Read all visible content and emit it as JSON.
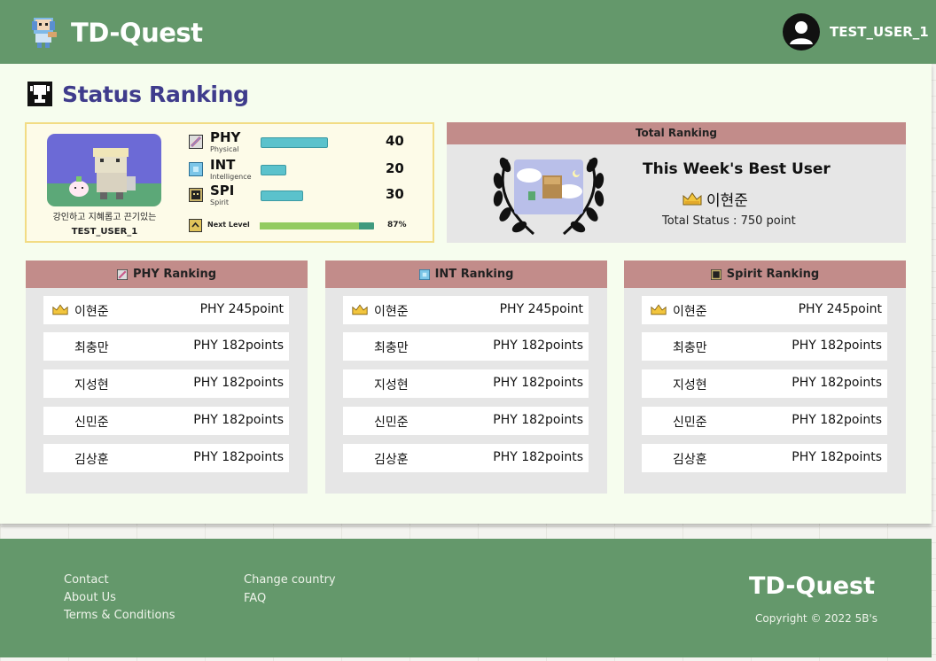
{
  "header": {
    "brand": "TD-Quest",
    "username": "TEST_USER_1",
    "logo_icon": "pixel-character-logo-icon",
    "avatar_icon": "user-avatar-icon",
    "bg_color": "#64986b"
  },
  "page": {
    "title": "Status Ranking",
    "title_icon": "trophy-icon"
  },
  "profile": {
    "caption": "강인하고 지혜롭고 끈기있는",
    "username": "TEST_USER_1",
    "stats": [
      {
        "abbr": "PHY",
        "full": "Physical",
        "value": "40",
        "icon": "phy-stat-icon",
        "level": 0.4
      },
      {
        "abbr": "INT",
        "full": "Intelligence",
        "value": "20",
        "icon": "int-stat-icon",
        "level": 0.15
      },
      {
        "abbr": "SPI",
        "full": "Spirit",
        "value": "30",
        "icon": "spi-stat-icon",
        "level": 0.25
      }
    ],
    "next_level": {
      "label": "Next Level",
      "percent_text": "87%",
      "percent": 87
    }
  },
  "total_ranking": {
    "heading": "Total Ranking",
    "best_title": "This Week's Best User",
    "best_user": "이현준",
    "total_status": "Total Status : 750 point"
  },
  "rankings": [
    {
      "heading": "PHY Ranking",
      "icon": "phy-stat-icon",
      "entries": [
        {
          "name": "이현준",
          "score": "PHY 245point",
          "crown": true
        },
        {
          "name": "최충만",
          "score": "PHY 182points",
          "crown": false
        },
        {
          "name": "지성현",
          "score": "PHY 182points",
          "crown": false
        },
        {
          "name": "신민준",
          "score": "PHY 182points",
          "crown": false
        },
        {
          "name": "김상훈",
          "score": "PHY 182points",
          "crown": false
        }
      ]
    },
    {
      "heading": "INT Ranking",
      "icon": "int-stat-icon",
      "entries": [
        {
          "name": "이현준",
          "score": "PHY 245point",
          "crown": true
        },
        {
          "name": "최충만",
          "score": "PHY 182points",
          "crown": false
        },
        {
          "name": "지성현",
          "score": "PHY 182points",
          "crown": false
        },
        {
          "name": "신민준",
          "score": "PHY 182points",
          "crown": false
        },
        {
          "name": "김상훈",
          "score": "PHY 182points",
          "crown": false
        }
      ]
    },
    {
      "heading": "Spirit Ranking",
      "icon": "spi-stat-icon",
      "entries": [
        {
          "name": "이현준",
          "score": "PHY 245point",
          "crown": true
        },
        {
          "name": "최충만",
          "score": "PHY 182points",
          "crown": false
        },
        {
          "name": "지성현",
          "score": "PHY 182points",
          "crown": false
        },
        {
          "name": "신민준",
          "score": "PHY 182points",
          "crown": false
        },
        {
          "name": "김상훈",
          "score": "PHY 182points",
          "crown": false
        }
      ]
    }
  ],
  "footer": {
    "links_col1": [
      "Contact",
      "About Us",
      "Terms & Conditions"
    ],
    "links_col2": [
      "Change country",
      "FAQ"
    ],
    "brand": "TD-Quest",
    "copyright": "Copyright © 2022 5B's"
  }
}
